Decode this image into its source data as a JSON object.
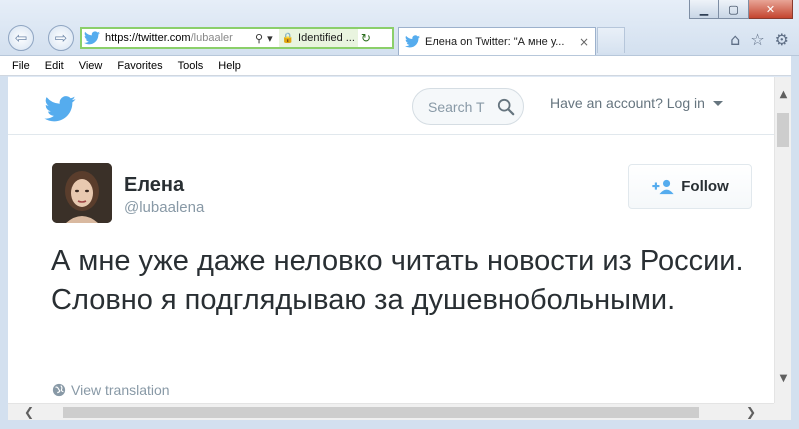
{
  "browser": {
    "window_controls": {
      "minimize": "▁",
      "maximize": "▢",
      "close": "✕"
    },
    "nav": {
      "back": "⇦",
      "forward": "⇨"
    },
    "address": {
      "url_host": "https://twitter.com",
      "url_rest": "/lubaaler",
      "search_glyph": "⚲",
      "dropdown_glyph": "▾",
      "lock_glyph": "🔒",
      "security_text": "Identified ...",
      "refresh_glyph": "↻"
    },
    "tab": {
      "label": "Елена on Twitter: \"А мне у...",
      "close": "×"
    },
    "tools": {
      "home": "⌂",
      "favorites": "☆",
      "settings": "⚙"
    },
    "menu": [
      "File",
      "Edit",
      "View",
      "Favorites",
      "Tools",
      "Help"
    ]
  },
  "header": {
    "search_placeholder": "Search T",
    "account_text": "Have an account? Log in"
  },
  "profile": {
    "name": "Елена",
    "handle": "@lubaalena",
    "follow_label": "Follow"
  },
  "tweet": {
    "text": "А мне уже даже неловко читать новости из России. Словно я подглядываю за душевнобольными.",
    "translate_label": "View translation"
  },
  "scrollbars": {
    "up": "▲",
    "down": "▼",
    "left": "❮",
    "right": "❯"
  },
  "colors": {
    "twitter_blue": "#55acee",
    "text": "#292f33",
    "muted": "#8899a6"
  }
}
